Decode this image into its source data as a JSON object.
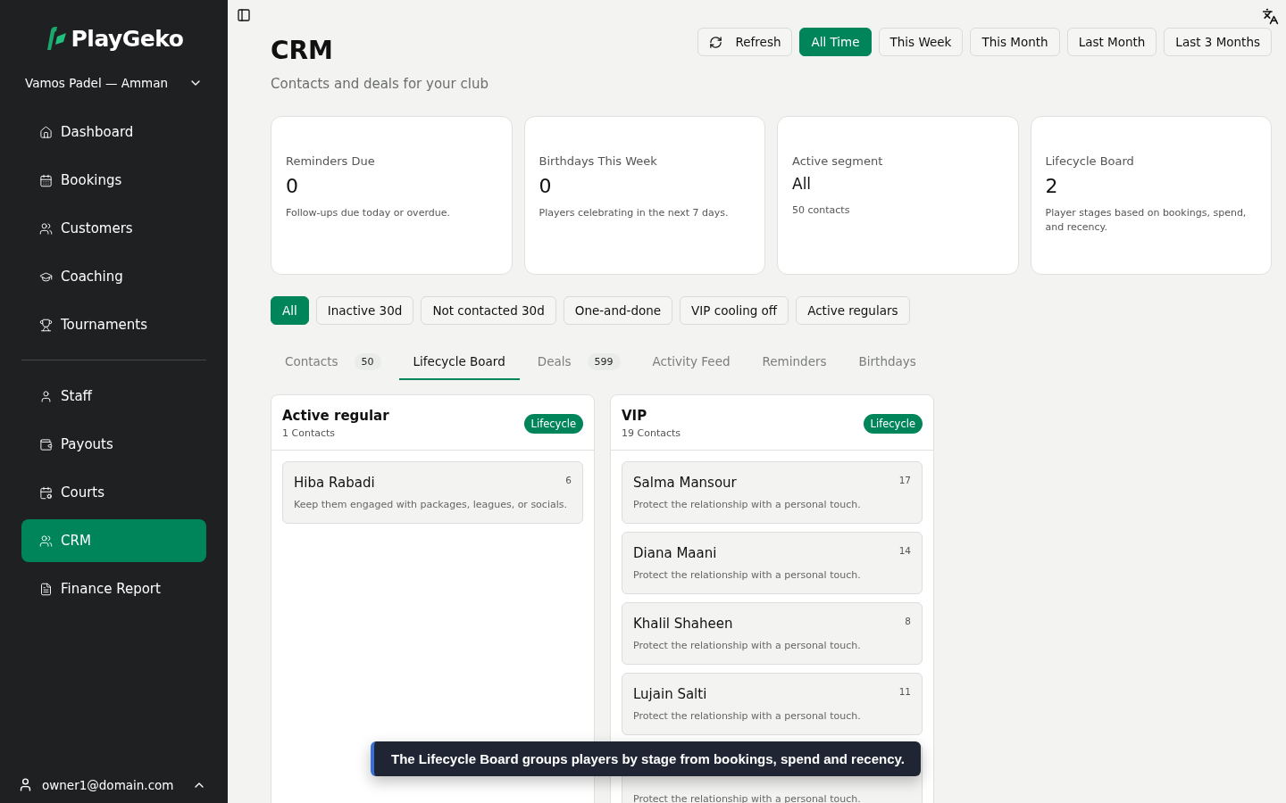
{
  "brand": {
    "name": "PlayGeko"
  },
  "club": {
    "name": "Vamos Padel — Amman"
  },
  "nav": [
    {
      "label": "Dashboard",
      "selected": false
    },
    {
      "label": "Bookings",
      "selected": false
    },
    {
      "label": "Customers",
      "selected": false
    },
    {
      "label": "Coaching",
      "selected": false
    },
    {
      "label": "Tournaments",
      "selected": false
    }
  ],
  "nav_admin": [
    {
      "label": "Staff",
      "selected": false
    },
    {
      "label": "Payouts",
      "selected": false
    },
    {
      "label": "Courts",
      "selected": false
    },
    {
      "label": "CRM",
      "selected": true
    },
    {
      "label": "Finance Report",
      "selected": false
    }
  ],
  "account": {
    "email": "owner1@domain.com"
  },
  "header": {
    "title": "CRM",
    "subtitle": "Contacts and deals for your club"
  },
  "refresh_button": "Refresh",
  "ranges": [
    {
      "label": "All Time",
      "selected": true
    },
    {
      "label": "This Week",
      "selected": false
    },
    {
      "label": "This Month",
      "selected": false
    },
    {
      "label": "Last Month",
      "selected": false
    },
    {
      "label": "Last 3 Months",
      "selected": false
    }
  ],
  "stats": [
    {
      "label": "Reminders Due",
      "value": "0",
      "note": "Follow-ups due today or overdue.",
      "kind": "number"
    },
    {
      "label": "Birthdays This Week",
      "value": "0",
      "note": "Players celebrating in the next 7 days.",
      "kind": "number"
    },
    {
      "label": "Active segment",
      "value": "All",
      "note": "50 contacts",
      "kind": "text"
    },
    {
      "label": "Lifecycle Board",
      "value": "2",
      "note": "Player stages based on bookings, spend, and recency.",
      "kind": "number"
    }
  ],
  "segments": [
    {
      "label": "All",
      "selected": true
    },
    {
      "label": "Inactive 30d",
      "selected": false
    },
    {
      "label": "Not contacted 30d",
      "selected": false
    },
    {
      "label": "One-and-done",
      "selected": false
    },
    {
      "label": "VIP cooling off",
      "selected": false
    },
    {
      "label": "Active regulars",
      "selected": false
    }
  ],
  "tabs": [
    {
      "label": "Contacts",
      "count": "50",
      "selected": false
    },
    {
      "label": "Lifecycle Board",
      "selected": true
    },
    {
      "label": "Deals",
      "count": "599",
      "selected": false
    },
    {
      "label": "Activity Feed",
      "selected": false
    },
    {
      "label": "Reminders",
      "selected": false
    },
    {
      "label": "Birthdays",
      "selected": false
    }
  ],
  "columns": [
    {
      "title": "Active regular",
      "count": "1 Contacts",
      "badge": "Lifecycle",
      "cards": [
        {
          "name": "Hiba Rabadi",
          "score": "6",
          "note": "Keep them engaged with packages, leagues, or socials."
        }
      ]
    },
    {
      "title": "VIP",
      "count": "19 Contacts",
      "badge": "Lifecycle",
      "cards": [
        {
          "name": "Salma Mansour",
          "score": "17",
          "note": "Protect the relationship with a personal touch."
        },
        {
          "name": "Diana Maani",
          "score": "14",
          "note": "Protect the relationship with a personal touch."
        },
        {
          "name": "Khalil Shaheen",
          "score": "8",
          "note": "Protect the relationship with a personal touch."
        },
        {
          "name": "Lujain Salti",
          "score": "11",
          "note": "Protect the relationship with a personal touch."
        },
        {
          "note": "Protect the relationship with a personal touch."
        }
      ]
    }
  ],
  "toast": {
    "message": "The Lifecycle Board groups players by stage from bookings, spend and recency."
  }
}
